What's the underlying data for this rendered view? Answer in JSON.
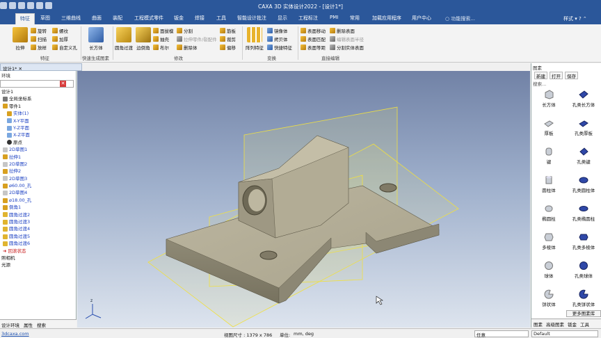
{
  "window": {
    "title": "CAXA 3D 实体设计2022 - [设计1*]"
  },
  "tabs": [
    {
      "label": "特征",
      "active": true
    },
    {
      "label": "草图"
    },
    {
      "label": "三维曲线"
    },
    {
      "label": "曲面"
    },
    {
      "label": "装配"
    },
    {
      "label": "工程模式零件"
    },
    {
      "label": "钣金"
    },
    {
      "label": "焊接"
    },
    {
      "label": "工具"
    },
    {
      "label": "智能设计批注"
    },
    {
      "label": "显示"
    },
    {
      "label": "工程标注"
    },
    {
      "label": "PMI"
    },
    {
      "label": "常用"
    },
    {
      "label": "加载应用程序"
    },
    {
      "label": "用户中心"
    }
  ],
  "help_search": {
    "placeholder": "功能搜索..."
  },
  "style_menu": "样式",
  "ribbon": {
    "g1": {
      "extrude": "拉伸",
      "rotate": "旋转",
      "sweep": "扫描",
      "loft": "放样",
      "thread": "螺纹",
      "thicken": "加厚",
      "custom_hole": "自定义孔",
      "label": "特征"
    },
    "g2": {
      "cuboid": "长方体",
      "label": "快速生成图素"
    },
    "g3": {
      "fillet": "圆角过渡",
      "chamfer": "边倒角",
      "draft": "面拔模",
      "shell": "抽壳",
      "boolean": "布尔",
      "split": "分割",
      "split_part": "拉伸零件/裂配件",
      "delete_body": "删除体",
      "rib": "筋板",
      "cut": "裁剪",
      "offset": "偏移",
      "label": "修改"
    },
    "g4": {
      "pattern": "阵列特征",
      "mirror": "镜像体",
      "copy": "拷贝体",
      "fast_feature": "快捷特征",
      "label": "变换"
    },
    "g5": {
      "face_move": "表面移动",
      "face_match": "表面匹配",
      "face_equidist": "表面等距",
      "delete_face": "删除表面",
      "edit_face_sew": "编辑表面半径",
      "split_body": "分割实体表面",
      "label": "直接编辑"
    }
  },
  "doc_tab": "设计1*",
  "left_panel": {
    "header": "环境",
    "tree": [
      {
        "label": "设计1",
        "style": "normal"
      },
      {
        "label": "全局坐标系",
        "style": "normal"
      },
      {
        "label": "零件1",
        "style": "normal"
      },
      {
        "label": "实体(1)",
        "style": "blue"
      },
      {
        "label": "X-Y平面",
        "style": "blue"
      },
      {
        "label": "Y-Z平面",
        "style": "blue"
      },
      {
        "label": "X-Z平面",
        "style": "blue"
      },
      {
        "label": "原点",
        "style": "normal"
      },
      {
        "label": "2D草图1",
        "style": "blue"
      },
      {
        "label": "拉伸1",
        "style": "blue"
      },
      {
        "label": "2D草图2",
        "style": "blue"
      },
      {
        "label": "拉伸2",
        "style": "blue"
      },
      {
        "label": "2D草图3",
        "style": "blue"
      },
      {
        "label": "ø60.00_孔",
        "style": "blue"
      },
      {
        "label": "2D草图4",
        "style": "blue"
      },
      {
        "label": "ø18.00_孔",
        "style": "blue"
      },
      {
        "label": "倒角1",
        "style": "blue"
      },
      {
        "label": "圆角过渡2",
        "style": "blue"
      },
      {
        "label": "圆角过渡3",
        "style": "blue"
      },
      {
        "label": "圆角过渡4",
        "style": "blue"
      },
      {
        "label": "圆角过渡5",
        "style": "blue"
      },
      {
        "label": "圆角过渡6",
        "style": "blue"
      },
      {
        "label": "回滚状态",
        "style": "red"
      },
      {
        "label": "照相机",
        "style": "normal"
      },
      {
        "label": "光源",
        "style": "normal"
      }
    ],
    "tabs": [
      "设计环境",
      "属性",
      "搜索"
    ]
  },
  "right_panel": {
    "title": "图素",
    "tools": [
      "新建",
      "打开",
      "保存"
    ],
    "search": "搜索...",
    "shapes": [
      [
        "长方体",
        "孔类长方体"
      ],
      [
        "厚板",
        "孔类厚板"
      ],
      [
        "键",
        "孔类键"
      ],
      [
        "圆柱体",
        "孔类圆柱体"
      ],
      [
        "椭圆柱",
        "孔类椭圆柱"
      ],
      [
        "多棱体",
        "孔类多棱体"
      ],
      [
        "球体",
        "孔类球体"
      ],
      [
        "饼状体",
        "孔类饼状体"
      ]
    ],
    "more_button": "更多图素库",
    "tabs": [
      "图素",
      "高级图素",
      "钣金",
      "工具"
    ]
  },
  "status": {
    "link": "3dcaxa.com",
    "view_size": "视图尺寸 : 1379 x 786",
    "units_label": "单位:",
    "units": "mm, deg",
    "select_mode": "任意",
    "config": "Default"
  }
}
